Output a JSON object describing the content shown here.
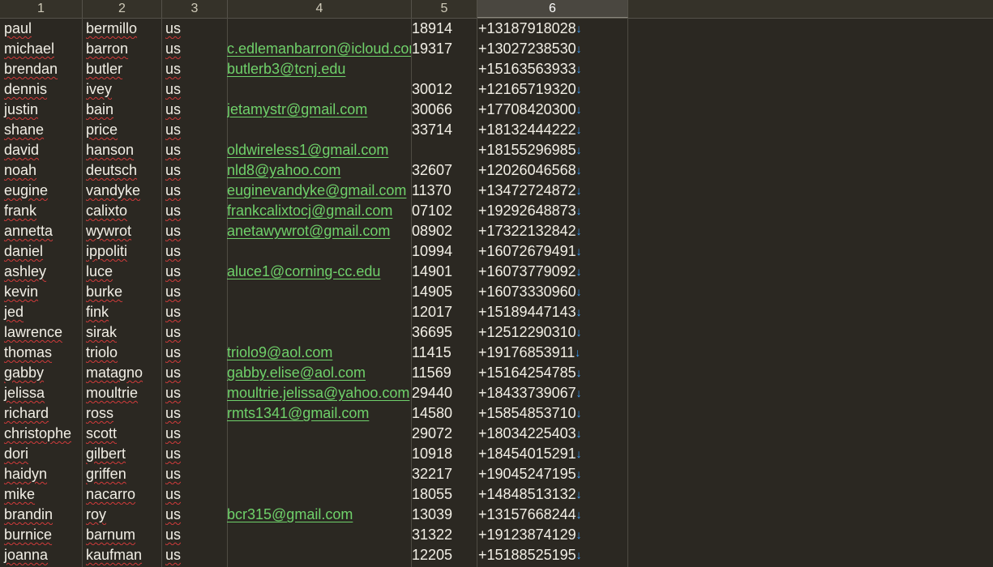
{
  "columns": [
    "1",
    "2",
    "3",
    "4",
    "5",
    "6"
  ],
  "active_column": "6",
  "rows": [
    {
      "first": "paul",
      "last": "bermillo",
      "country": "us",
      "email": "",
      "zip": "18914",
      "phone": "+13187918028"
    },
    {
      "first": "michael",
      "last": "barron",
      "country": "us",
      "email": "c.edlemanbarron@icloud.com",
      "zip": "19317",
      "phone": "+13027238530"
    },
    {
      "first": "brendan",
      "last": "butler",
      "country": "us",
      "email": "butlerb3@tcnj.edu",
      "zip": "",
      "phone": "+15163563933"
    },
    {
      "first": "dennis",
      "last": "ivey",
      "country": "us",
      "email": "",
      "zip": "30012",
      "phone": "+12165719320"
    },
    {
      "first": "justin",
      "last": "bain",
      "country": "us",
      "email": "jetamystr@gmail.com",
      "zip": "30066",
      "phone": "+17708420300"
    },
    {
      "first": "shane",
      "last": "price",
      "country": "us",
      "email": "",
      "zip": "33714",
      "phone": "+18132444222"
    },
    {
      "first": "david",
      "last": "hanson",
      "country": "us",
      "email": "oldwireless1@gmail.com",
      "zip": "",
      "phone": "+18155296985"
    },
    {
      "first": "noah",
      "last": "deutsch",
      "country": "us",
      "email": "nld8@yahoo.com",
      "zip": "32607",
      "phone": "+12026046568"
    },
    {
      "first": "eugine",
      "last": "vandyke",
      "country": "us",
      "email": "euginevandyke@gmail.com",
      "zip": "11370",
      "phone": "+13472724872"
    },
    {
      "first": "frank",
      "last": "calixto",
      "country": "us",
      "email": "frankcalixtocj@gmail.com",
      "zip": "07102",
      "phone": "+19292648873"
    },
    {
      "first": "annetta",
      "last": "wywrot",
      "country": "us",
      "email": "anetawywrot@gmail.com",
      "zip": "08902",
      "phone": "+17322132842"
    },
    {
      "first": "daniel",
      "last": "ippoliti",
      "country": "us",
      "email": "",
      "zip": "10994",
      "phone": "+16072679491"
    },
    {
      "first": "ashley",
      "last": "luce",
      "country": "us",
      "email": "aluce1@corning-cc.edu",
      "zip": "14901",
      "phone": "+16073779092"
    },
    {
      "first": "kevin",
      "last": "burke",
      "country": "us",
      "email": "",
      "zip": "14905",
      "phone": "+16073330960"
    },
    {
      "first": "jed",
      "last": "fink",
      "country": "us",
      "email": "",
      "zip": "12017",
      "phone": "+15189447143"
    },
    {
      "first": "lawrence",
      "last": "sirak",
      "country": "us",
      "email": "",
      "zip": "36695",
      "phone": "+12512290310"
    },
    {
      "first": "thomas",
      "last": "triolo",
      "country": "us",
      "email": "triolo9@aol.com",
      "zip": "11415",
      "phone": "+19176853911"
    },
    {
      "first": "gabby",
      "last": "matagno",
      "country": "us",
      "email": "gabby.elise@aol.com",
      "zip": "11569",
      "phone": "+15164254785"
    },
    {
      "first": "jelissa",
      "last": "moultrie",
      "country": "us",
      "email": "moultrie.jelissa@yahoo.com",
      "zip": "29440",
      "phone": "+18433739067"
    },
    {
      "first": "richard",
      "last": "ross",
      "country": "us",
      "email": "rmts1341@gmail.com",
      "zip": "14580",
      "phone": "+15854853710"
    },
    {
      "first": "christophe",
      "last": "scott",
      "country": "us",
      "email": "",
      "zip": "29072",
      "phone": "+18034225403"
    },
    {
      "first": "dori",
      "last": "gilbert",
      "country": "us",
      "email": "",
      "zip": "10918",
      "phone": "+18454015291"
    },
    {
      "first": "haidyn",
      "last": "griffen",
      "country": "us",
      "email": "",
      "zip": "32217",
      "phone": "+19045247195"
    },
    {
      "first": "mike",
      "last": "nacarro",
      "country": "us",
      "email": "",
      "zip": "18055",
      "phone": "+14848513132"
    },
    {
      "first": "brandin",
      "last": "roy",
      "country": "us",
      "email": "bcr315@gmail.com",
      "zip": "13039",
      "phone": "+13157668244"
    },
    {
      "first": "burnice",
      "last": "barnum",
      "country": "us",
      "email": "",
      "zip": "31322",
      "phone": "+19123874129"
    },
    {
      "first": "joanna",
      "last": "kaufman",
      "country": "us",
      "email": "",
      "zip": "12205",
      "phone": "+15188525195"
    }
  ],
  "icons": {
    "phone_suffix": "down-arrow-icon"
  },
  "colors": {
    "background": "#2b2822",
    "link": "#6fd16a",
    "spellcheck": "#d23b3b",
    "arrow": "#3aa0ff"
  }
}
